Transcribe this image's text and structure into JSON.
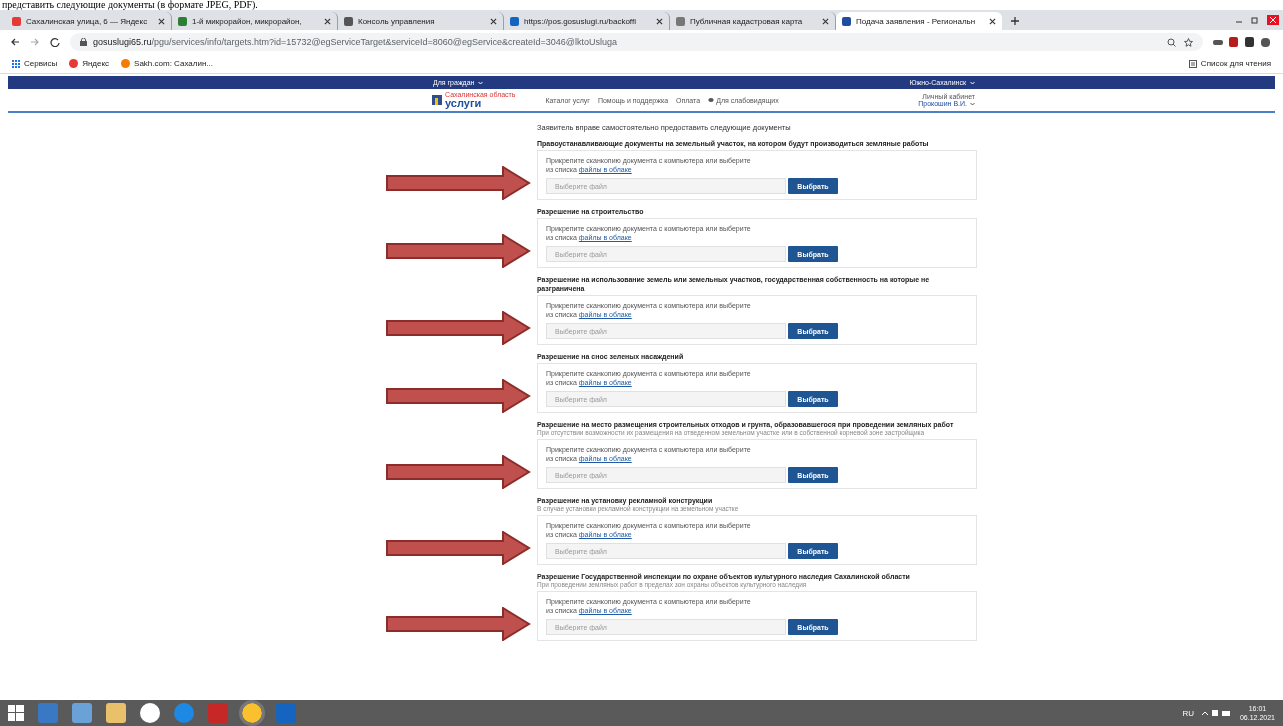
{
  "document_text": "представить следующие документы (в формате JPEG, PDF).",
  "browser": {
    "tabs": [
      {
        "title": "Сахалинская улица, 6 — Яндекс",
        "selected": false
      },
      {
        "title": "1-й микрорайон, микрорайон,",
        "selected": false
      },
      {
        "title": "Консоль управления",
        "selected": false
      },
      {
        "title": "https://pos.gosuslugi.ru/backoffi",
        "selected": false
      },
      {
        "title": "Публичная кадастровая карта",
        "selected": false
      },
      {
        "title": "Подача заявления - Региональн",
        "selected": true
      }
    ],
    "url_host": "gosuslugi65.ru",
    "url_path": "/pgu/services/info/targets.htm?id=15732@egServiceTarget&serviceId=8060@egService&createId=3046@lktoUsluga",
    "bookmarks": [
      "Сервисы",
      "Яндекс",
      "Sakh.com: Сахалин..."
    ],
    "reading_list": "Список для чтения"
  },
  "site": {
    "top_left": "Для граждан",
    "top_right": "Южно-Сахалинск",
    "logo_caption": "Сахалинская область",
    "logo": "услуги",
    "nav": [
      "Каталог услуг",
      "Помощь и поддержка",
      "Оплата",
      "Для слабовидящих"
    ],
    "account_label": "Личный кабинет",
    "user": "Прокошин В.И."
  },
  "heading": "Заявитель вправе самостоятельно предоставить следующие документы",
  "documents": [
    {
      "title": "Правоустанавливающие документы на земельный участок, на котором будут производиться земляные работы",
      "prompt": "Прикрепите сканкопию документа с компьютера или выберите",
      "prompt2": "из списка",
      "link": "файлы в облаке",
      "placeholder": "Выберите файл",
      "button": "Выбрать"
    },
    {
      "title": "Разрешение на строительство",
      "prompt": "Прикрепите сканкопию документа с компьютера или выберите",
      "prompt2": "из списка",
      "link": "файлы в облаке",
      "placeholder": "Выберите файл",
      "button": "Выбрать"
    },
    {
      "title": "Разрешение на использование земель или земельных участков, государственная собственность на которые не разграничена",
      "prompt": "Прикрепите сканкопию документа с компьютера или выберите",
      "prompt2": "из списка",
      "link": "файлы в облаке",
      "placeholder": "Выберите файл",
      "button": "Выбрать"
    },
    {
      "title": "Разрешение на снос зеленых насаждений",
      "prompt": "Прикрепите сканкопию документа с компьютера или выберите",
      "prompt2": "из списка",
      "link": "файлы в облаке",
      "placeholder": "Выберите файл",
      "button": "Выбрать"
    },
    {
      "title": "Разрешение на место размещения строительных отходов и грунта, образовавшегося при проведении земляных работ",
      "hint": "При отсутствии возможности их размещения на отведенном земельном участке или в собственной корневой зоне застройщика",
      "prompt": "Прикрепите сканкопию документа с компьютера или выберите",
      "prompt2": "из списка",
      "link": "файлы в облаке",
      "placeholder": "Выберите файл",
      "button": "Выбрать"
    },
    {
      "title": "Разрешение на установку рекламной конструкции",
      "hint": "В случае установки рекламной конструкции на земельном участке",
      "prompt": "Прикрепите сканкопию документа с компьютера или выберите",
      "prompt2": "из списка",
      "link": "файлы в облаке",
      "placeholder": "Выберите файл",
      "button": "Выбрать"
    },
    {
      "title": "Разрешение Государственной инспекции по охране объектов культурного наследия Сахалинской области",
      "hint": "При проведении земляных работ в пределах зон охраны объектов культурного наследия",
      "prompt": "Прикрепите сканкопию документа с компьютера или выберите",
      "prompt2": "из списка",
      "link": "файлы в облаке",
      "placeholder": "Выберите файл",
      "button": "Выбрать"
    }
  ],
  "taskbar": {
    "language": "RU",
    "time": "16:01",
    "date": "06.12.2021"
  }
}
